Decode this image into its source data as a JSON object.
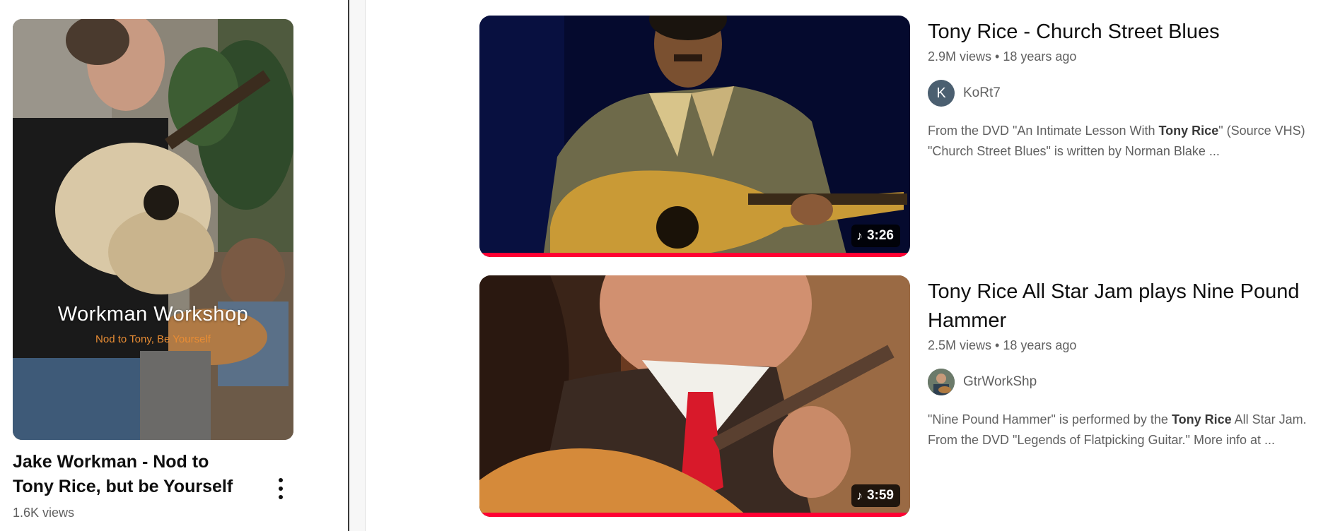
{
  "short": {
    "overlay_title": "Workman Workshop",
    "overlay_subtitle": "Nod to Tony, Be Yourself",
    "title": "Jake Workman - Nod to Tony Rice, but be Yourself",
    "views": "1.6K views",
    "menu_icon": "more-vertical-icon"
  },
  "results": [
    {
      "title": "Tony Rice - Church Street Blues",
      "views": "2.9M views",
      "separator": "•",
      "age": "18 years ago",
      "duration": "3:26",
      "duration_icon": "music-note-icon",
      "channel": {
        "name": "KoRt7",
        "initial": "K",
        "avatar_color": "#4b5f70"
      },
      "desc_line1_a": "From the DVD \"An Intimate Lesson With ",
      "desc_line1_bold": "Tony Rice",
      "desc_line1_b": "\" (Source VHS)",
      "desc_line2": "\"Church Street Blues\" is written by Norman Blake ...",
      "watched_fraction": 1.0
    },
    {
      "title": "Tony Rice All Star Jam plays Nine Pound Hammer",
      "views": "2.5M views",
      "separator": "•",
      "age": "18 years ago",
      "duration": "3:59",
      "duration_icon": "music-note-icon",
      "channel": {
        "name": "GtrWorkShp",
        "initial": "",
        "avatar_color": "#3d4a3a"
      },
      "desc_line1_a": "\"Nine Pound Hammer\" is performed by the ",
      "desc_line1_bold": "Tony Rice",
      "desc_line1_b": " All Star Jam.",
      "desc_line2": "From the DVD \"Legends of Flatpicking Guitar.\" More info at ...",
      "watched_fraction": 1.0
    }
  ],
  "colors": {
    "progress": "#ff0033",
    "meta_text": "#606060",
    "overlay_subtitle": "#e98d34"
  }
}
